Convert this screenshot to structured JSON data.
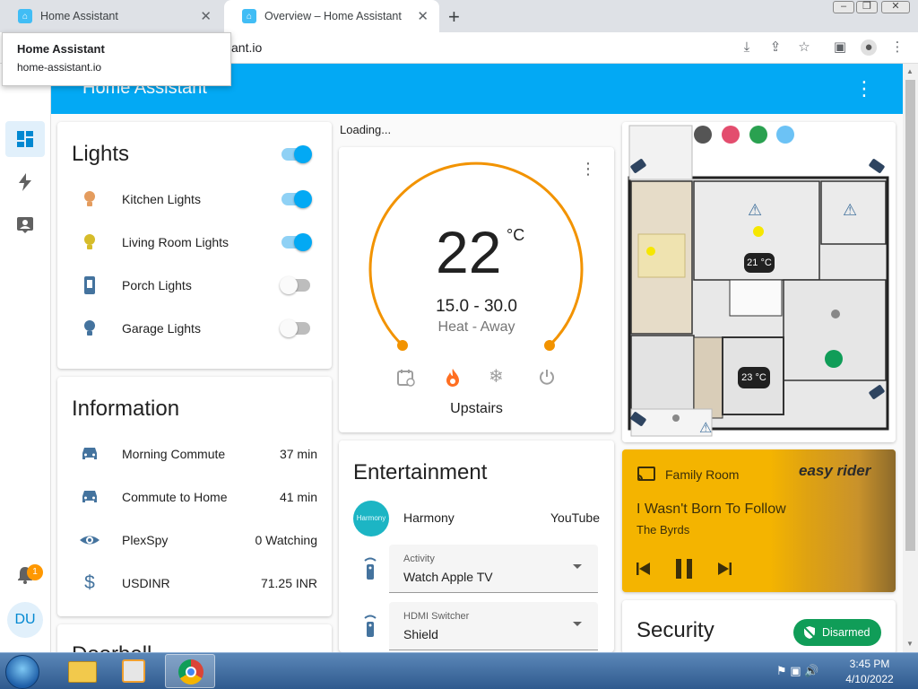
{
  "browser": {
    "tabs": [
      {
        "title": "Home Assistant"
      },
      {
        "title": "Overview – Home Assistant"
      }
    ],
    "url_fragment": "ant.io",
    "tooltip": {
      "title": "Home Assistant",
      "domain": "home-assistant.io"
    }
  },
  "header": {
    "title": "Home Assistant"
  },
  "sidebar": {
    "items": [
      {
        "icon": "overview-grid-icon"
      },
      {
        "icon": "energy-bolt-icon"
      },
      {
        "icon": "profile-card-icon"
      }
    ],
    "notification_count": "1",
    "avatar_initials": "DU"
  },
  "lights": {
    "title": "Lights",
    "items": [
      {
        "label": "Kitchen Lights",
        "icon": "bulb-icon",
        "color": "#e49c5e",
        "on": true
      },
      {
        "label": "Living Room Lights",
        "icon": "bulb-icon",
        "color": "#d6bc2a",
        "on": true
      },
      {
        "label": "Porch Lights",
        "icon": "wall-light-icon",
        "color": "#44739e",
        "on": false
      },
      {
        "label": "Garage Lights",
        "icon": "bulb-icon",
        "color": "#44739e",
        "on": false
      }
    ]
  },
  "information": {
    "title": "Information",
    "items": [
      {
        "label": "Morning Commute",
        "value": "37 min",
        "icon": "car-icon"
      },
      {
        "label": "Commute to Home",
        "value": "41 min",
        "icon": "car-icon"
      },
      {
        "label": "PlexSpy",
        "value": "0 Watching",
        "icon": "eye-icon"
      },
      {
        "label": "USDINR",
        "value": "71.25 INR",
        "icon": "dollar-icon"
      }
    ]
  },
  "doorbell": {
    "title": "Doorbell"
  },
  "loading_text": "Loading...",
  "thermostat": {
    "current": "22",
    "unit": "°C",
    "range": "15.0 - 30.0",
    "mode": "Heat - Away",
    "name": "Upstairs",
    "accent": "#f29300"
  },
  "floorplan": {
    "temps": [
      "21 °C",
      "23 °C"
    ]
  },
  "media": {
    "source": "Family Room",
    "song": "I Wasn't Born To Follow",
    "artist": "The Byrds",
    "art_text": "easy rider"
  },
  "entertainment": {
    "title": "Entertainment",
    "harmony_label": "Harmony",
    "harmony_logo": "Harmony",
    "harmony_value": "YouTube",
    "activity_label": "Activity",
    "activity_value": "Watch Apple TV",
    "hdmi_label": "HDMI Switcher",
    "hdmi_value": "Shield"
  },
  "security": {
    "title": "Security",
    "status": "Disarmed",
    "color": "#109d58"
  },
  "taskbar": {
    "time": "3:45 PM",
    "date": "4/10/2022"
  }
}
